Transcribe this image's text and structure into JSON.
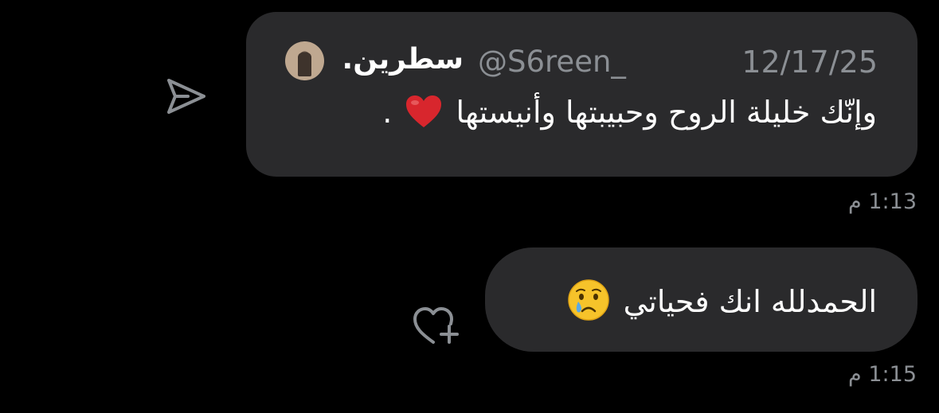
{
  "quoted_tweet": {
    "display_name": "سطرين.",
    "handle": "@S6reen_",
    "date": "12/17/25",
    "text": "وإنّك خليلة الروح وحبيبتها وأنيستها",
    "text_suffix": ".",
    "emoji": "red-heart"
  },
  "message": {
    "text": "الحمدلله انك فحياتي",
    "emoji": "crying-face"
  },
  "timestamps": {
    "first": "1:13 م",
    "second": "1:15 م"
  },
  "icons": {
    "share": "share-arrow-icon",
    "react": "add-reaction-heart-icon"
  },
  "colors": {
    "background": "#000000",
    "bubble": "#2a2a2c",
    "text": "#ffffff",
    "secondary": "#8b8f94",
    "heart": "#d8262d"
  }
}
